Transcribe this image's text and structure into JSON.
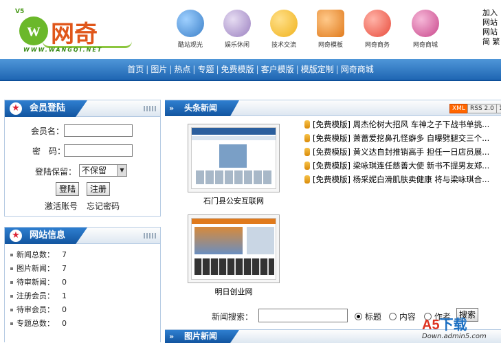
{
  "header": {
    "logo": {
      "version": "V5",
      "name": "网奇",
      "url": "WWW.WANGQI.NET"
    },
    "nav_icons": [
      {
        "label": "酷站观光",
        "icon": "globe-icon",
        "color": "#3a7fc8"
      },
      {
        "label": "娱乐休闲",
        "icon": "gift-icon",
        "color": "#9a7fc0"
      },
      {
        "label": "技术交流",
        "icon": "people-icon",
        "color": "#f0b21b"
      },
      {
        "label": "网奇模板",
        "icon": "box-icon",
        "color": "#e07a1c"
      },
      {
        "label": "网奇商务",
        "icon": "graduate-icon",
        "color": "#e84a3a"
      },
      {
        "label": "网奇商城",
        "icon": "shopping-icon",
        "color": "#c8458a"
      }
    ],
    "top_links": [
      "加入",
      "网站",
      "网站",
      "简 繁"
    ]
  },
  "navbar": {
    "items": [
      "首页",
      "图片",
      "热点",
      "专题",
      "免费模版",
      "客户模版",
      "模版定制",
      "网奇商城"
    ],
    "separator": "|"
  },
  "login": {
    "title": "会员登陆",
    "username_label": "会员名：",
    "password_label": "密　码：",
    "keep_label": "登陆保留：",
    "keep_value": "不保留",
    "login_button": "登陆",
    "register_button": "注册",
    "activate_link": "激活账号",
    "forgot_link": "忘记密码"
  },
  "site_info": {
    "title": "网站信息",
    "stats": [
      {
        "label": "新闻总数：",
        "value": "7"
      },
      {
        "label": "图片新闻：",
        "value": "7"
      },
      {
        "label": "待审新闻：",
        "value": "0"
      },
      {
        "label": "注册会员：",
        "value": "1"
      },
      {
        "label": "待审会员：",
        "value": "0"
      },
      {
        "label": "专题总数：",
        "value": "0"
      }
    ]
  },
  "headlines": {
    "title": "头条新闻",
    "double_arrow": "»",
    "badges": {
      "xml": "XML",
      "rss": "RSS 2.0",
      "extra": "1"
    },
    "thumbnails": [
      {
        "caption": "石门县公安互联网"
      },
      {
        "caption": "明日创业网"
      }
    ],
    "news": [
      "[免费模版] 周杰伦树大招风 车神之子下战书单挑...",
      "[免费模版] 萧蔷爱挖鼻孔怪癖多 自曝劈腿交三个...",
      "[免费模版] 黄义达自封推销高手 担任一日店员展...",
      "[免费模版] 梁咏琪连任慈善大使 新书不提男友郑...",
      "[免费模版] 杨采妮白滑肌肤卖健康 将与梁咏琪合..."
    ]
  },
  "search": {
    "label": "新闻搜索：",
    "value": "",
    "options": [
      "标题",
      "内容",
      "作者"
    ],
    "selected": "标题",
    "button": "搜索"
  },
  "photo_news": {
    "title": "图片新闻",
    "double_arrow": "»"
  },
  "watermark": {
    "brand_a": "A5",
    "brand_b": "下载",
    "domain": "Down.admin5.com"
  }
}
